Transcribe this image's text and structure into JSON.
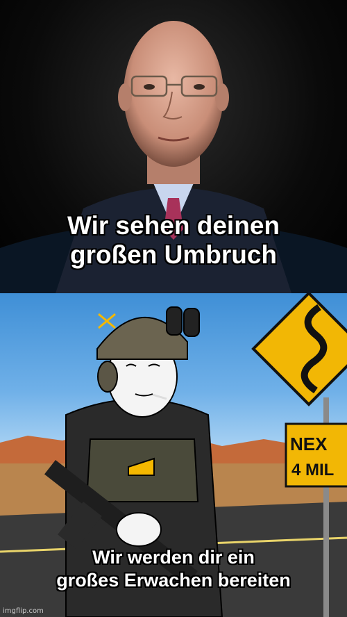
{
  "top_caption": {
    "line1": "Wir sehen deinen",
    "line2": "großen Umbruch"
  },
  "bottom_caption": {
    "line1": "Wir werden dir ein",
    "line2": "großes Erwachen bereiten"
  },
  "signs": {
    "next_sign_line1": "NEX",
    "next_sign_line2": "4 MIL"
  },
  "watermark": "imgflip.com",
  "colors": {
    "caption_text": "#ffffff",
    "caption_outline": "#000000",
    "road_sign_yellow": "#f2b705",
    "sky": "#6fb0e8"
  },
  "icons": {
    "top_image": "man-portrait-photo",
    "bottom_image": "soldier-wojak-cartoon",
    "road_sign": "winding-road-sign-icon"
  }
}
